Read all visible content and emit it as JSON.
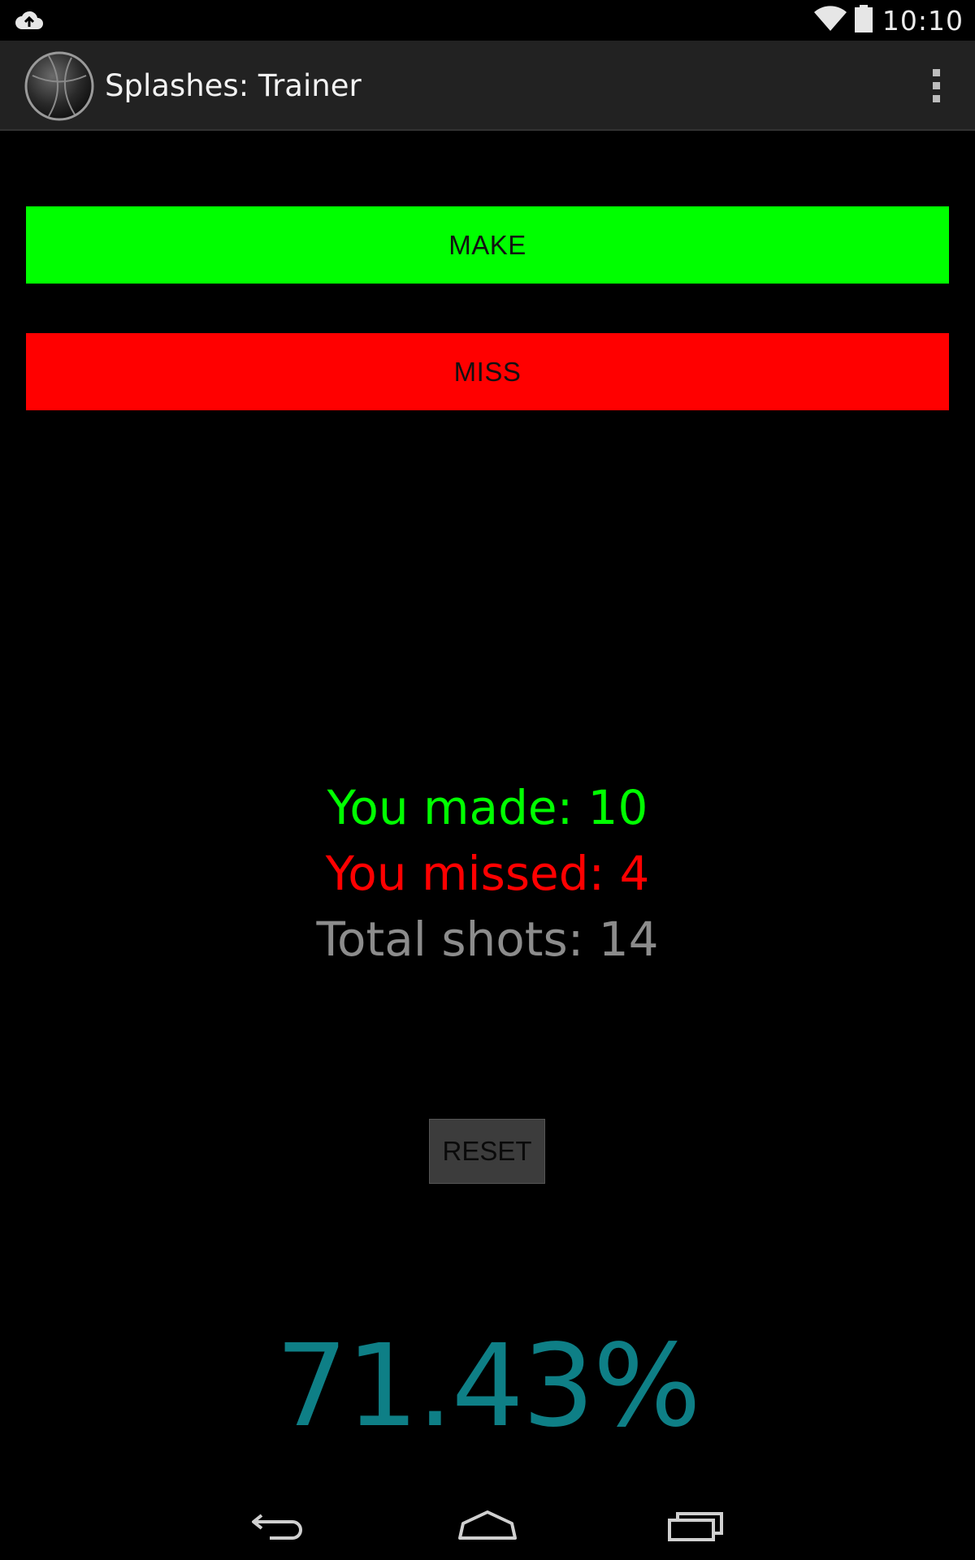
{
  "status_bar": {
    "time": "10:10",
    "icons": [
      "cloud-upload-icon",
      "wifi-icon",
      "battery-icon"
    ]
  },
  "action_bar": {
    "title": "Splashes: Trainer",
    "app_icon": "basketball-icon",
    "overflow_icon": "overflow-menu-icon"
  },
  "buttons": {
    "make_label": "MAKE",
    "miss_label": "MISS",
    "reset_label": "RESET"
  },
  "stats": {
    "made": "You made: 10",
    "missed": "You missed: 4",
    "total": "Total shots: 14",
    "percentage": "71.43%"
  },
  "colors": {
    "make": "#00ff00",
    "miss": "#ff0000",
    "total": "#8c8c8c",
    "percentage": "#0e7f86",
    "action_bar": "#222222"
  },
  "nav_bar": {
    "icons": [
      "back-icon",
      "home-icon",
      "recents-icon"
    ]
  }
}
